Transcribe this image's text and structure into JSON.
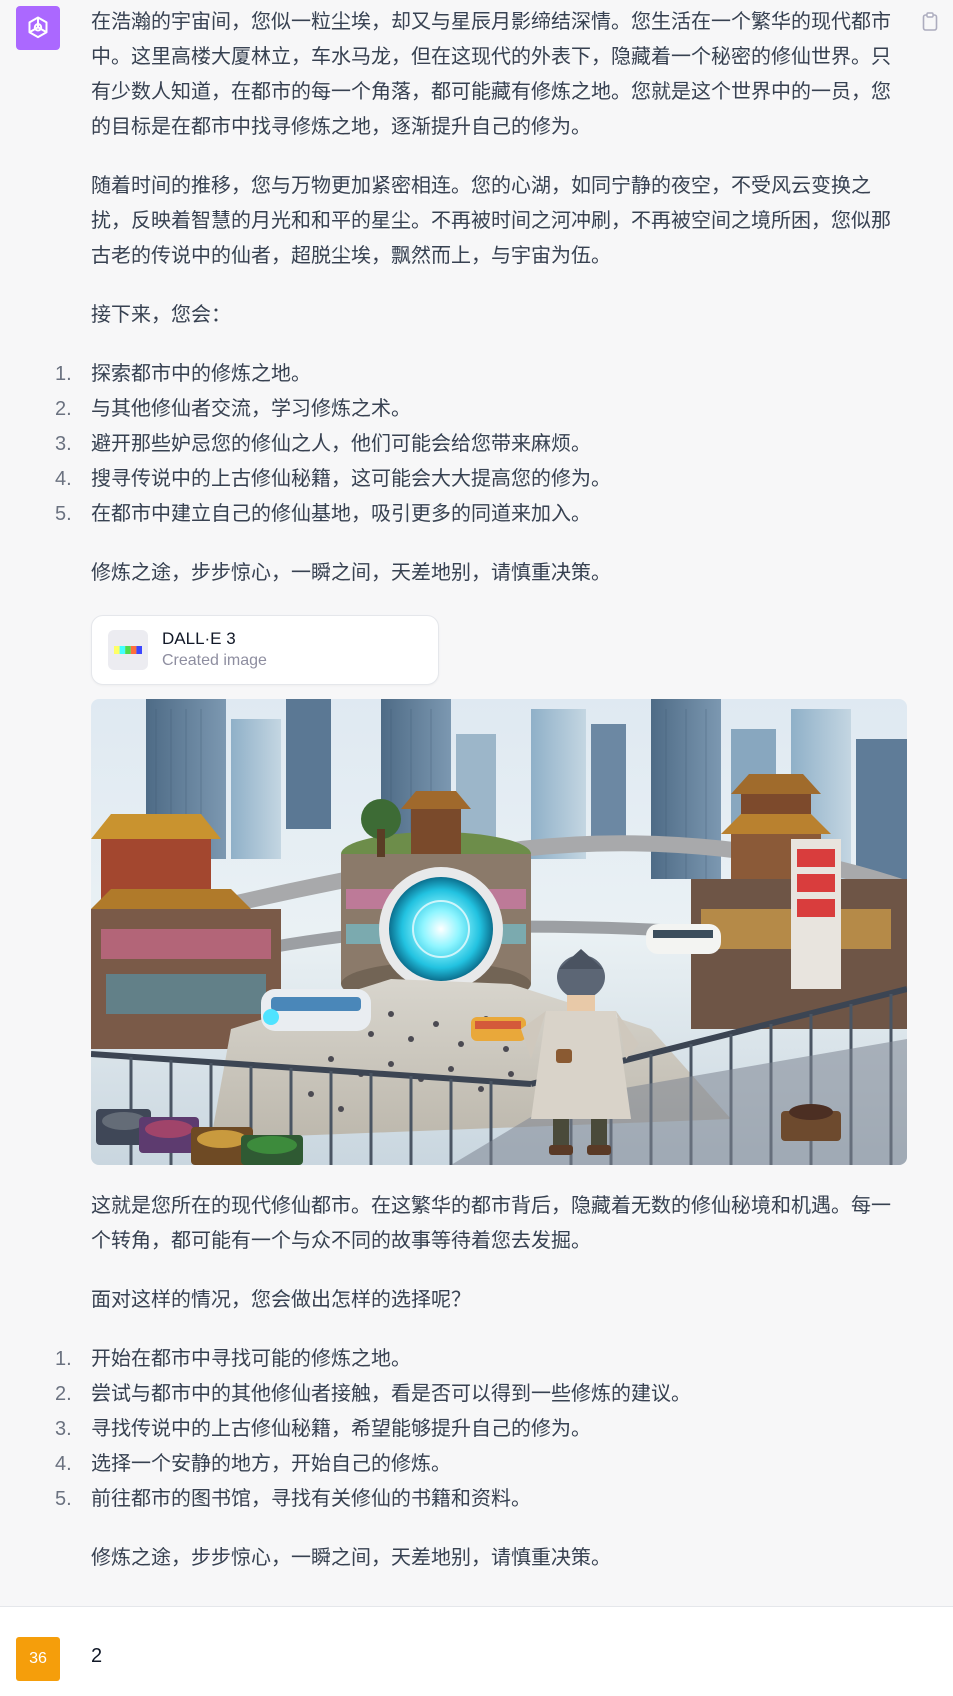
{
  "assistant": {
    "intro_paragraphs": [
      "在浩瀚的宇宙间，您似一粒尘埃，却又与星辰月影缔结深情。您生活在一个繁华的现代都市中。这里高楼大厦林立，车水马龙，但在这现代的外表下，隐藏着一个秘密的修仙世界。只有少数人知道，在都市的每一个角落，都可能藏有修炼之地。您就是这个世界中的一员，您的目标是在都市中找寻修炼之地，逐渐提升自己的修为。",
      "随着时间的推移，您与万物更加紧密相连。您的心湖，如同宁静的夜空，不受风云变换之扰，反映着智慧的月光和和平的星尘。不再被时间之河冲刷，不再被空间之境所困，您似那古老的传说中的仙者，超脱尘埃，飘然而上，与宇宙为伍。",
      "接下来，您会："
    ],
    "first_options": [
      {
        "num": "1.",
        "text": "探索都市中的修炼之地。"
      },
      {
        "num": "2.",
        "text": "与其他修仙者交流，学习修炼之术。"
      },
      {
        "num": "3.",
        "text": "避开那些妒忌您的修仙之人，他们可能会给您带来麻烦。"
      },
      {
        "num": "4.",
        "text": "搜寻传说中的上古修仙秘籍，这可能会大大提高您的修为。"
      },
      {
        "num": "5.",
        "text": "在都市中建立自己的修仙基地，吸引更多的同道来加入。"
      }
    ],
    "closing_1": "修炼之途，步步惊心，一瞬之间，天差地别，请慎重决策。",
    "dalle_card": {
      "title": "DALL·E 3",
      "subtitle": "Created image"
    },
    "after_image_paragraphs": [
      "这就是您所在的现代修仙都市。在这繁华的都市背后，隐藏着无数的修仙秘境和机遇。每一个转角，都可能有一个与众不同的故事等待着您去发掘。",
      "面对这样的情况，您会做出怎样的选择呢？"
    ],
    "second_options": [
      {
        "num": "1.",
        "text": "开始在都市中寻找可能的修炼之地。"
      },
      {
        "num": "2.",
        "text": "尝试与都市中的其他修仙者接触，看是否可以得到一些修炼的建议。"
      },
      {
        "num": "3.",
        "text": "寻找传说中的上古修仙秘籍，希望能够提升自己的修为。"
      },
      {
        "num": "4.",
        "text": "选择一个安静的地方，开始自己的修炼。"
      },
      {
        "num": "5.",
        "text": "前往都市的图书馆，寻找有关修仙的书籍和资料。"
      }
    ],
    "closing_2": "修炼之途，步步惊心，一瞬之间，天差地别，请慎重决策。",
    "avatar_icon": "openai-logo-icon",
    "avatar_color": "#ab68ff",
    "copy_icon": "clipboard-icon"
  },
  "user": {
    "avatar_label": "36",
    "avatar_color": "#f59e0b",
    "message": "2"
  }
}
